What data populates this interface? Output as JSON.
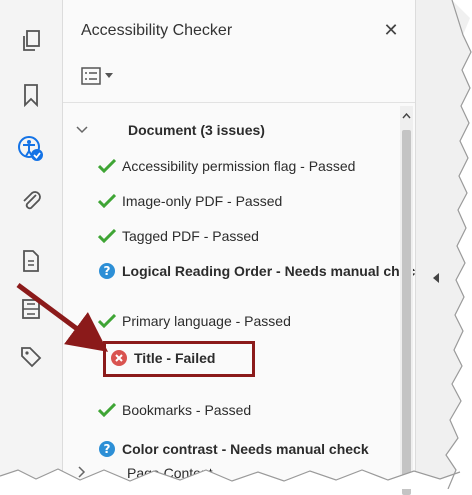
{
  "panel": {
    "title": "Accessibility Checker",
    "close_glyph": "✕"
  },
  "tree": {
    "section": "Document (3 issues)",
    "items": [
      {
        "label": "Accessibility permission flag - Passed",
        "status": "passed",
        "bold": false
      },
      {
        "label": "Image-only PDF - Passed",
        "status": "passed",
        "bold": false
      },
      {
        "label": "Tagged PDF - Passed",
        "status": "passed",
        "bold": false
      },
      {
        "label": "Logical Reading Order - Needs manual check",
        "status": "manual",
        "bold": true
      },
      {
        "label": "Primary language - Passed",
        "status": "passed",
        "bold": false
      },
      {
        "label": "Title - Failed",
        "status": "failed",
        "bold": true
      },
      {
        "label": "Bookmarks - Passed",
        "status": "passed",
        "bold": false
      },
      {
        "label": "Color contrast - Needs manual check",
        "status": "manual",
        "bold": true
      }
    ],
    "next_section": "Page Content"
  },
  "rail": {
    "icons": [
      "pages-icon",
      "bookmark-icon",
      "accessibility-icon",
      "attachment-icon",
      "document-properties-icon",
      "compare-icon",
      "tags-icon"
    ]
  },
  "colors": {
    "passed": "#3fa535",
    "manual": "#2d8fd6",
    "failed": "#d9534f",
    "highlight": "#8b1a1a",
    "accent": "#1473e6"
  }
}
